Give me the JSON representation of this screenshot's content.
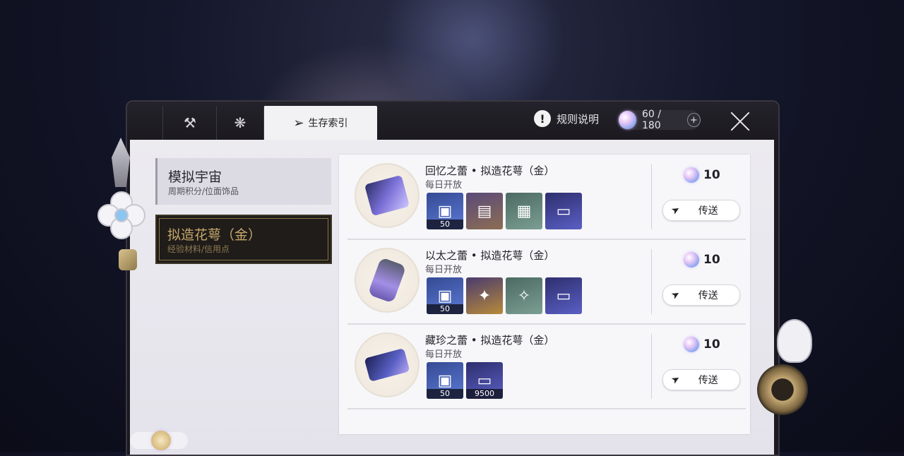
{
  "header": {
    "tabs": [
      {
        "icon": "hammer-icon",
        "label": ""
      },
      {
        "icon": "snowflake-icon",
        "label": ""
      },
      {
        "icon": "compass-icon",
        "label": "生存索引"
      }
    ],
    "rules_label": "规则说明",
    "stamina": {
      "current": "60",
      "max": "180",
      "display": "60 / 180",
      "plus": "+"
    }
  },
  "sidebar": {
    "items": [
      {
        "title": "模拟宇宙",
        "subtitle": "周期积分/位面饰品",
        "selected": false
      },
      {
        "title": "拟造花萼（金）",
        "subtitle": "经验材料/信用点",
        "selected": true
      }
    ]
  },
  "entries": [
    {
      "name": "回忆之蕾 • 拟造花萼（金）",
      "open": "每日开放",
      "cost": "10",
      "teleport": "传送",
      "rewards": [
        {
          "icon": "exp-card-icon",
          "count": "50"
        },
        {
          "icon": "book-icon",
          "count": ""
        },
        {
          "icon": "papers-icon",
          "count": ""
        },
        {
          "icon": "credit-card-icon",
          "count": ""
        }
      ]
    },
    {
      "name": "以太之蕾 • 拟造花萼（金）",
      "open": "每日开放",
      "cost": "10",
      "teleport": "传送",
      "rewards": [
        {
          "icon": "exp-card-icon",
          "count": "50"
        },
        {
          "icon": "golden-lantern-icon",
          "count": ""
        },
        {
          "icon": "dark-lantern-icon",
          "count": ""
        },
        {
          "icon": "credit-card-icon",
          "count": ""
        }
      ]
    },
    {
      "name": "藏珍之蕾 • 拟造花萼（金）",
      "open": "每日开放",
      "cost": "10",
      "teleport": "传送",
      "rewards": [
        {
          "icon": "exp-card-icon",
          "count": "50"
        },
        {
          "icon": "credit-card-icon",
          "count": "9500"
        }
      ]
    }
  ],
  "colors": {
    "accent_gold": "#c6a86a",
    "panel_bg": "#f7f7f9",
    "frame_dark": "#1c1a20",
    "stamina_orb": "#e7c6f6"
  }
}
